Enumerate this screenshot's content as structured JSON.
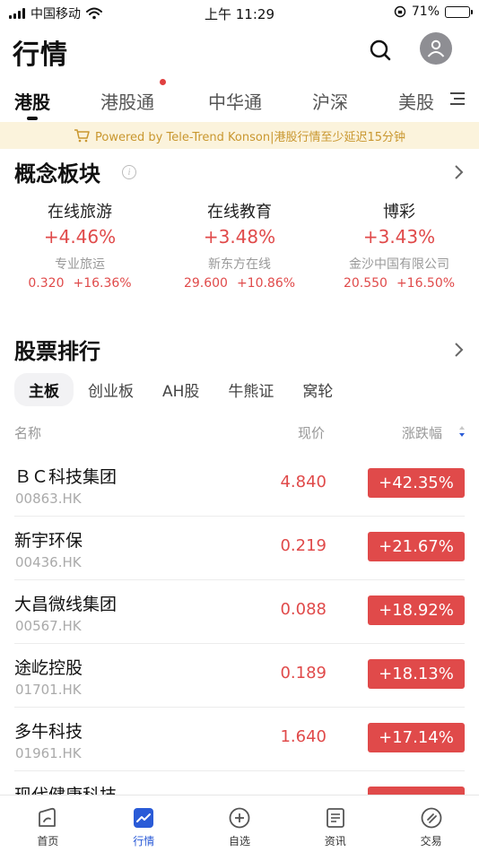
{
  "status_bar": {
    "carrier": "中国移动",
    "time": "上午 11:29",
    "battery": "71%",
    "battery_level": 0.71
  },
  "header": {
    "title": "行情"
  },
  "market_tabs": [
    {
      "label": "港股",
      "active": true
    },
    {
      "label": "港股通",
      "active": false,
      "dot": true
    },
    {
      "label": "中华通",
      "active": false
    },
    {
      "label": "沪深",
      "active": false
    },
    {
      "label": "美股",
      "active": false
    }
  ],
  "notice": {
    "text": "Powered by Tele-Trend Konson|港股行情至少延迟15分钟"
  },
  "concept": {
    "title": "概念板块",
    "items": [
      {
        "name": "在线旅游",
        "change": "+4.46%",
        "leader": "专业旅运",
        "leader_price": "0.320",
        "leader_change": "+16.36%"
      },
      {
        "name": "在线教育",
        "change": "+3.48%",
        "leader": "新东方在线",
        "leader_price": "29.600",
        "leader_change": "+10.86%"
      },
      {
        "name": "博彩",
        "change": "+3.43%",
        "leader": "金沙中国有限公司",
        "leader_price": "20.550",
        "leader_change": "+16.50%"
      }
    ]
  },
  "ranking": {
    "title": "股票排行",
    "tabs": [
      {
        "label": "主板",
        "active": true
      },
      {
        "label": "创业板",
        "active": false
      },
      {
        "label": "AH股",
        "active": false
      },
      {
        "label": "牛熊证",
        "active": false
      },
      {
        "label": "窝轮",
        "active": false
      }
    ],
    "columns": {
      "name": "名称",
      "price": "现价",
      "change": "涨跌幅"
    },
    "rows": [
      {
        "name": "ＢＣ科技集团",
        "code": "00863.HK",
        "price": "4.840",
        "change": "+42.35%"
      },
      {
        "name": "新宇环保",
        "code": "00436.HK",
        "price": "0.219",
        "change": "+21.67%"
      },
      {
        "name": "大昌微线集团",
        "code": "00567.HK",
        "price": "0.088",
        "change": "+18.92%"
      },
      {
        "name": "途屹控股",
        "code": "01701.HK",
        "price": "0.189",
        "change": "+18.13%"
      },
      {
        "name": "多牛科技",
        "code": "01961.HK",
        "price": "1.640",
        "change": "+17.14%"
      },
      {
        "name": "现代健康科技",
        "code": "",
        "price": "",
        "change": ""
      }
    ]
  },
  "bottom_nav": [
    {
      "label": "首页",
      "icon": "home-icon",
      "active": false
    },
    {
      "label": "行情",
      "icon": "chart-icon",
      "active": true
    },
    {
      "label": "自选",
      "icon": "plus-circle-icon",
      "active": false
    },
    {
      "label": "资讯",
      "icon": "news-icon",
      "active": false
    },
    {
      "label": "交易",
      "icon": "trade-icon",
      "active": false
    }
  ],
  "colors": {
    "up_red": "#e04a4a",
    "accent_blue": "#2a5bd7",
    "notice_bg": "#fbf3dc",
    "notice_text": "#c9972f"
  }
}
